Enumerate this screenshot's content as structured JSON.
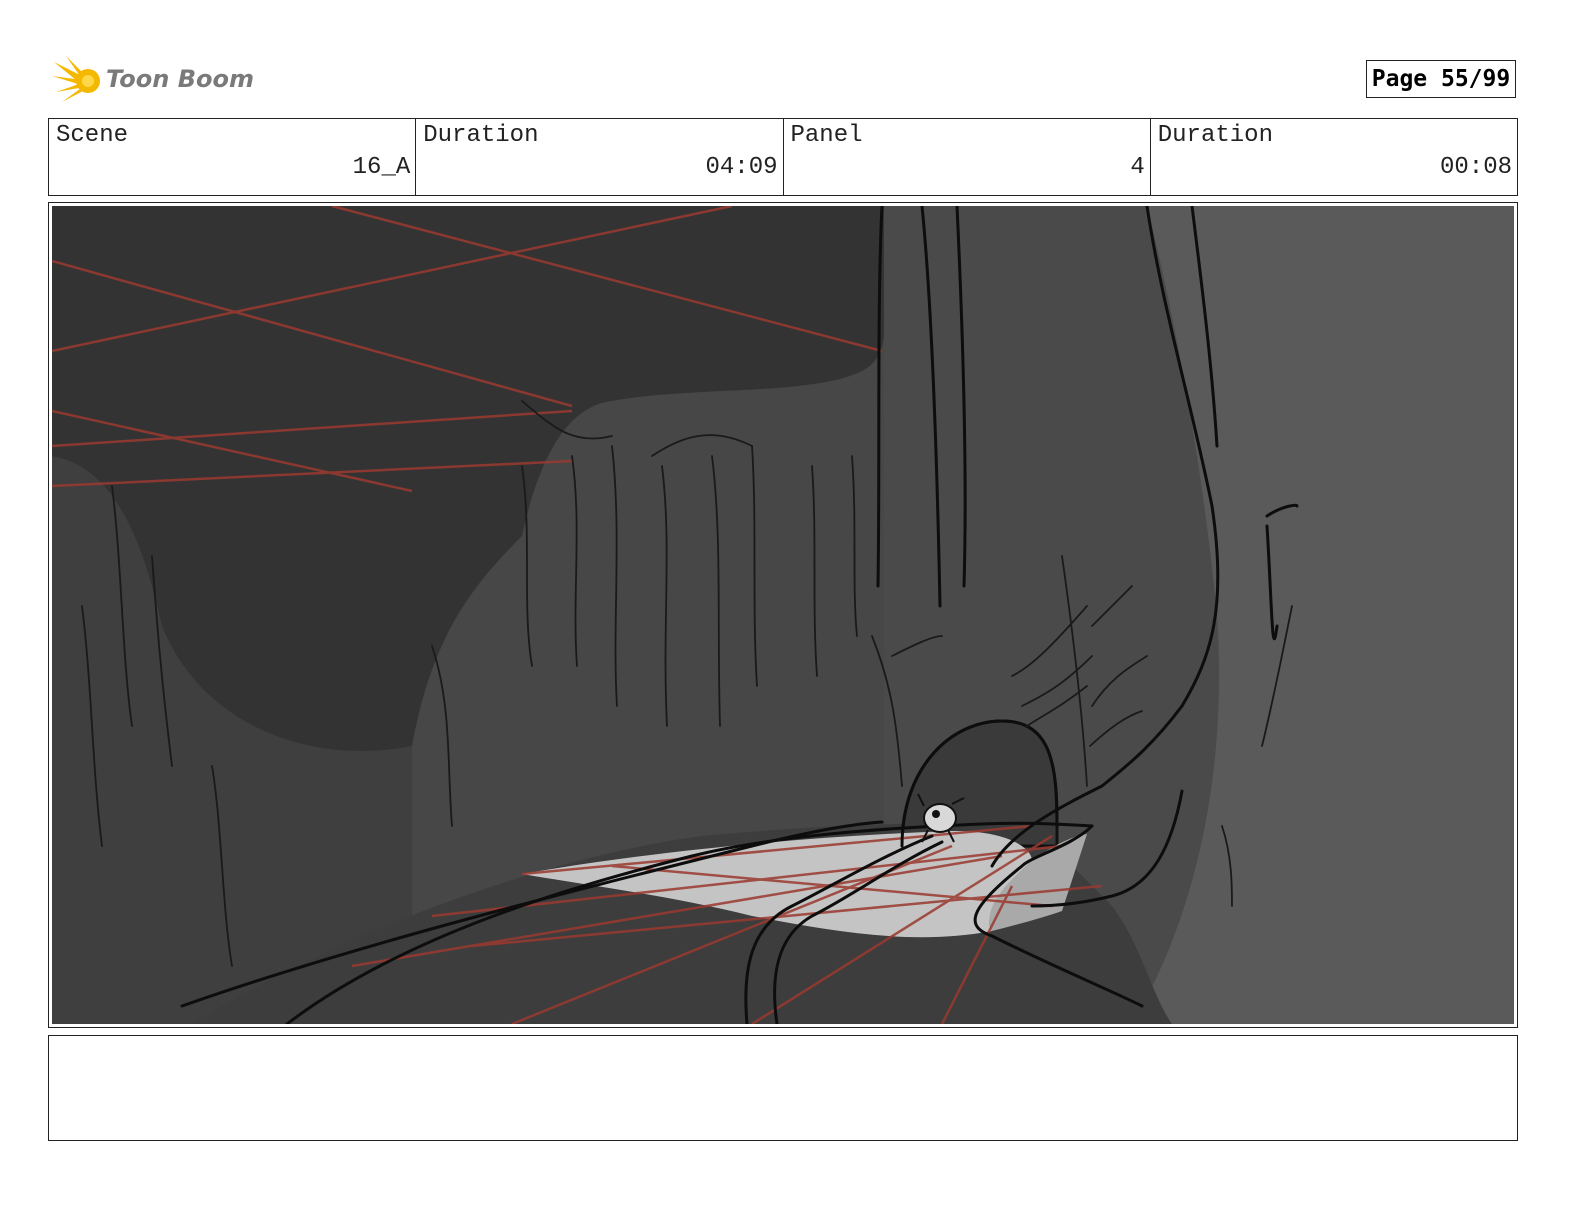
{
  "header": {
    "logo_text": "Toon Boom",
    "page_label": "Page 55/99"
  },
  "info": [
    {
      "label": "Scene",
      "value": "16_A"
    },
    {
      "label": "Duration",
      "value": "04:09"
    },
    {
      "label": "Panel",
      "value": "4"
    },
    {
      "label": "Duration",
      "value": "00:08"
    }
  ],
  "notes": "",
  "colors": {
    "logo_star": "#f5b800",
    "logo_text": "#7a7a7a",
    "sky": "#333333",
    "rock": "#474747",
    "road": "#c4c4c4",
    "guide_lines": "#9a3a30"
  }
}
